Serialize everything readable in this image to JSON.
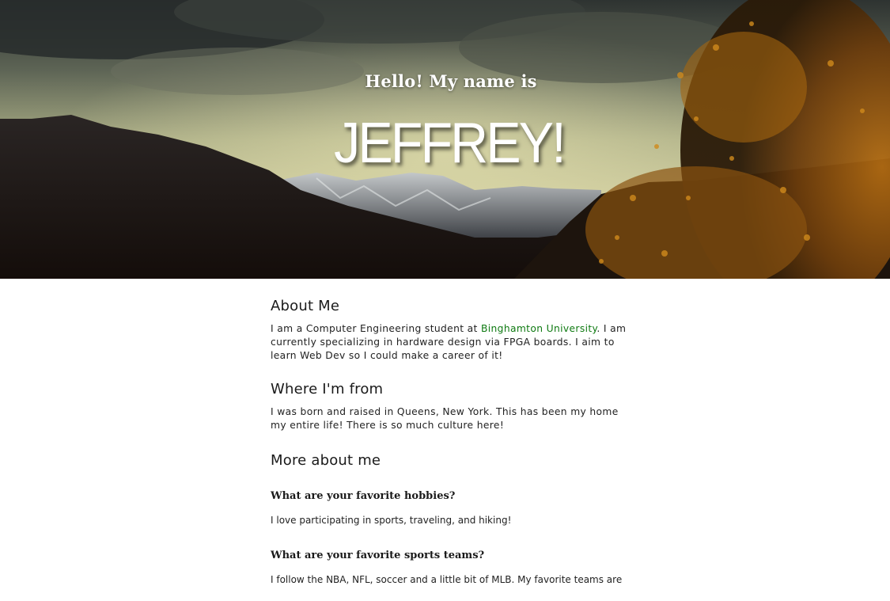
{
  "hero": {
    "greeting": "Hello! My name is",
    "name": "JEFFREY!"
  },
  "about": {
    "heading": "About Me",
    "text_before_link": "I am a Computer Engineering student at ",
    "link_text": "Binghamton University",
    "text_after_link": ". I am currently specializing in hardware design via FPGA boards. I aim to learn Web Dev so I could make a career of it!"
  },
  "from": {
    "heading": "Where I'm from",
    "text": "I was born and raised in Queens, New York. This has been my home my entire life! There is so much culture here!"
  },
  "more": {
    "heading": "More about me",
    "q1": "What are your favorite hobbies?",
    "a1": "I love participating in sports, traveling, and hiking!",
    "q2": "What are your favorite sports teams?",
    "a2": "I follow the NBA, NFL, soccer and a little bit of MLB. My favorite teams are"
  },
  "colors": {
    "link": "#0f7a12",
    "background": "#ffffff"
  }
}
